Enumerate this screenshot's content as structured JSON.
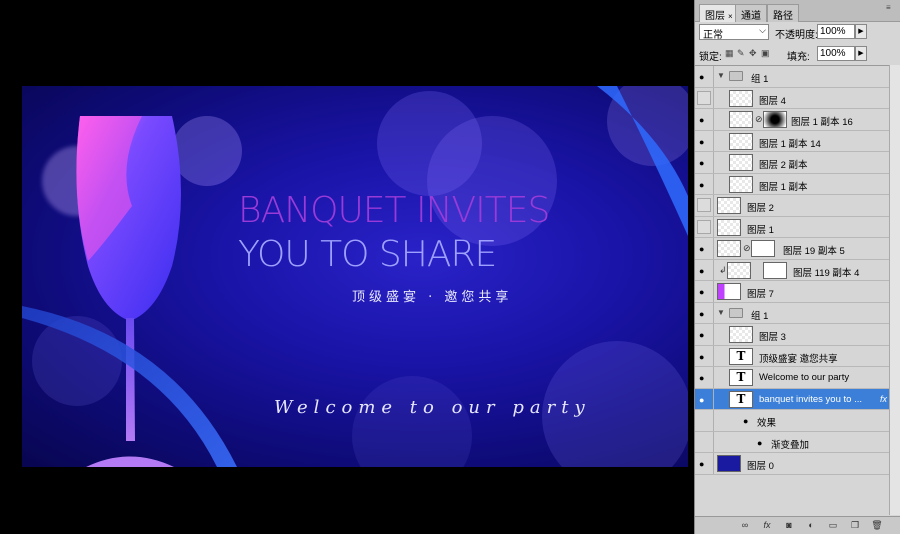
{
  "canvas": {
    "headline_line1": "BANQUET INVITES",
    "headline_line2": "YOU TO SHARE",
    "tagline_cn": "顶级盛宴 · 邀您共享",
    "script_text": "Welcome to our party"
  },
  "layers_panel": {
    "tabs": [
      {
        "label": "图层",
        "close": "×"
      },
      {
        "label": "通道"
      },
      {
        "label": "路径"
      }
    ],
    "blend_mode": "正常",
    "opacity_label": "不透明度:",
    "opacity_value": "100%",
    "lock_label": "锁定:",
    "fill_label": "填充:",
    "fill_value": "100%",
    "layers": [
      {
        "name": "组 1",
        "kind": "group",
        "visible": true
      },
      {
        "name": "图层 4",
        "kind": "layer",
        "visible": false
      },
      {
        "name": "图层 1 副本 16",
        "kind": "layer-mask",
        "visible": true
      },
      {
        "name": "图层 1 副本 14",
        "kind": "layer",
        "visible": true
      },
      {
        "name": "图层 2 副本",
        "kind": "layer",
        "visible": true
      },
      {
        "name": "图层 1 副本",
        "kind": "layer",
        "visible": true
      },
      {
        "name": "图层 2",
        "kind": "layer",
        "visible": false
      },
      {
        "name": "图层 1",
        "kind": "layer",
        "visible": false
      },
      {
        "name": "图层 19 副本 5",
        "kind": "layer-mask",
        "visible": true
      },
      {
        "name": "图层 119 副本 4",
        "kind": "layer-mask",
        "visible": true
      },
      {
        "name": "图层 7",
        "kind": "layer",
        "visible": true
      },
      {
        "name": "组 1",
        "kind": "group",
        "visible": true
      },
      {
        "name": "图层 3",
        "kind": "layer",
        "visible": true
      },
      {
        "name": "顶级盛宴 邀您共享",
        "kind": "text",
        "visible": true
      },
      {
        "name": "Welcome to our party",
        "kind": "text",
        "visible": true
      },
      {
        "name": "banquet invites you to ...",
        "kind": "text",
        "visible": true,
        "selected": true,
        "fx": "fx"
      },
      {
        "name": "效果",
        "kind": "effect",
        "visible": true
      },
      {
        "name": "渐变叠加",
        "kind": "effect-item",
        "visible": true
      },
      {
        "name": "图层 0",
        "kind": "layer",
        "visible": true
      }
    ],
    "footer_icons": [
      "link-icon",
      "fx-icon",
      "mask-icon",
      "adjustment-icon",
      "group-icon",
      "new-layer-icon",
      "trash-icon"
    ],
    "fx_label": "fx",
    "text_thumb": "T"
  },
  "colors": {
    "canvas_bg": "#1a14a8",
    "headline_magenta": "#9a3ad8",
    "headline_lavender": "#9fa0ff",
    "selection_blue": "#3b7fd8"
  }
}
